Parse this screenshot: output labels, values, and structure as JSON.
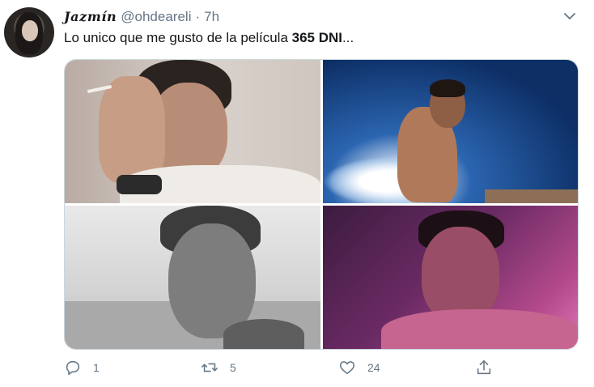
{
  "tweet": {
    "author_name": "Jazmín",
    "handle": "@ohdeareli",
    "separator": "·",
    "time": "7h",
    "text_before": "Lo unico que me gusto de la película ",
    "text_bold": "365 DNI",
    "text_after": "..."
  },
  "actions": {
    "reply_count": "1",
    "retweet_count": "5",
    "like_count": "24"
  },
  "colors": {
    "text": "#14171a",
    "secondary": "#657786",
    "border": "#ccd6dd"
  },
  "icons": [
    "caret-down-icon",
    "reply-icon",
    "retweet-icon",
    "heart-icon",
    "share-icon"
  ]
}
